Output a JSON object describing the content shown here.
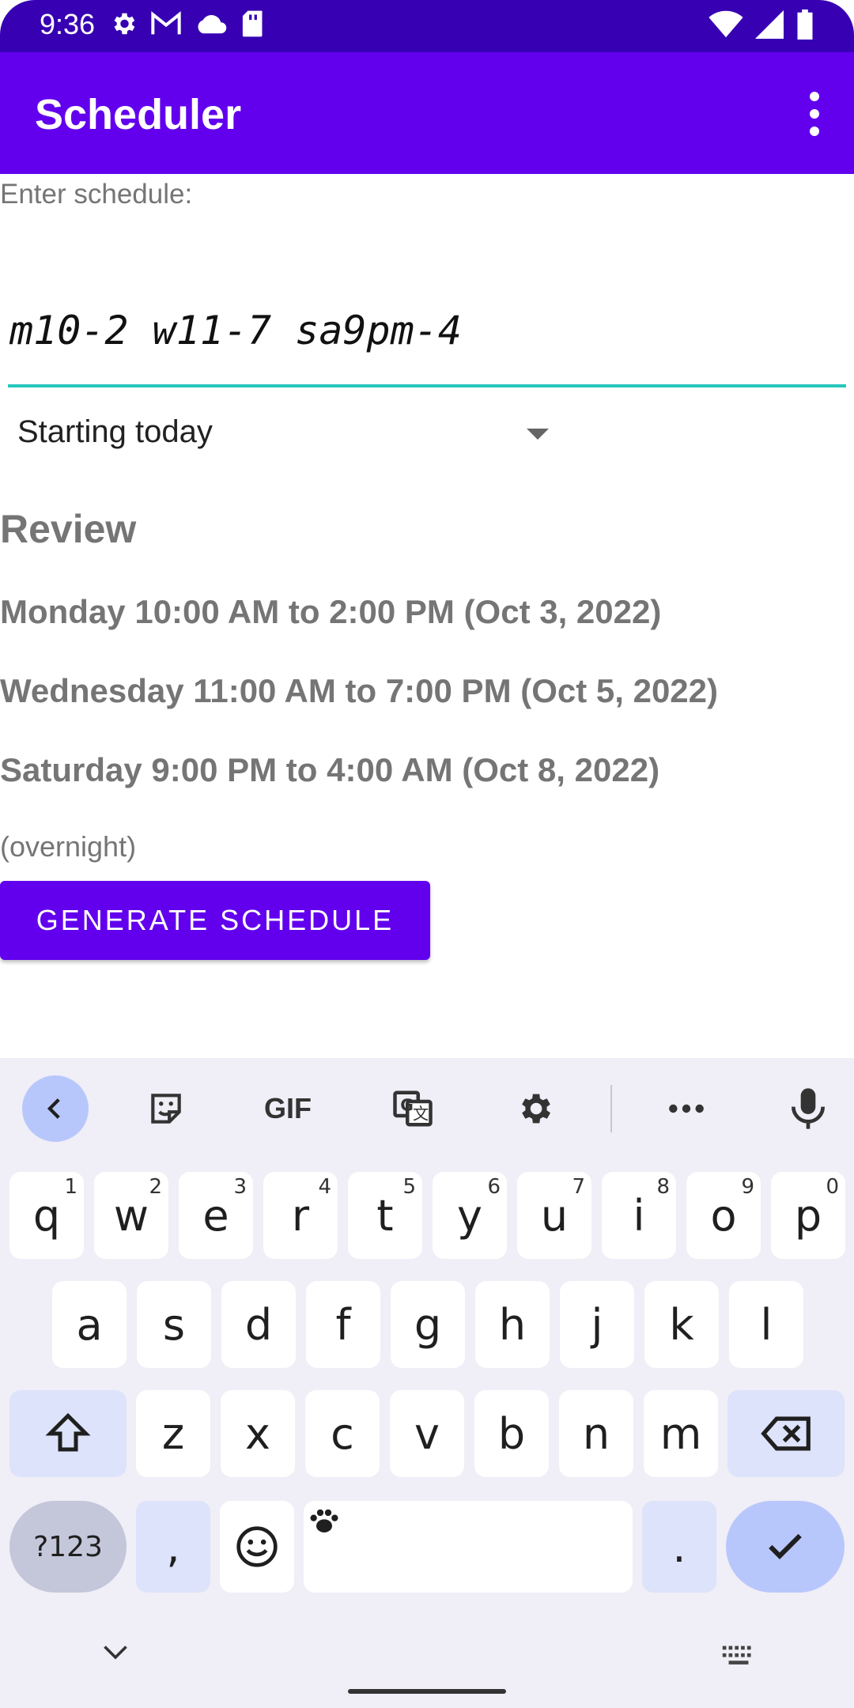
{
  "status_bar": {
    "time": "9:36",
    "left_icons": [
      "settings-icon",
      "gmail-icon",
      "cloud-icon",
      "sd-card-icon"
    ],
    "right_icons": [
      "wifi-icon",
      "signal-icon",
      "battery-icon"
    ]
  },
  "app_bar": {
    "title": "Scheduler",
    "overflow_icon": "more-vert-icon"
  },
  "form": {
    "label": "Enter schedule:",
    "input_value": "m10-2 w11-7 sa9pm-4",
    "spinner_value": "Starting today"
  },
  "review": {
    "title": "Review",
    "lines": [
      "Monday 10:00 AM to 2:00 PM (Oct 3, 2022)",
      "Wednesday 11:00 AM to 7:00 PM (Oct 5, 2022)",
      "Saturday 9:00 PM to 4:00 AM (Oct 8, 2022)"
    ],
    "note": "(overnight)"
  },
  "generate_button": "GENERATE SCHEDULE",
  "keyboard": {
    "toolbar": [
      "back-icon",
      "sticker-icon",
      "GIF",
      "translate-icon",
      "gear-icon",
      "more-horiz-icon",
      "mic-icon"
    ],
    "row1": [
      {
        "k": "q",
        "n": "1"
      },
      {
        "k": "w",
        "n": "2"
      },
      {
        "k": "e",
        "n": "3"
      },
      {
        "k": "r",
        "n": "4"
      },
      {
        "k": "t",
        "n": "5"
      },
      {
        "k": "y",
        "n": "6"
      },
      {
        "k": "u",
        "n": "7"
      },
      {
        "k": "i",
        "n": "8"
      },
      {
        "k": "o",
        "n": "9"
      },
      {
        "k": "p",
        "n": "0"
      }
    ],
    "row2": [
      "a",
      "s",
      "d",
      "f",
      "g",
      "h",
      "j",
      "k",
      "l"
    ],
    "row3": [
      "z",
      "x",
      "c",
      "v",
      "b",
      "n",
      "m"
    ],
    "symbols_key": "?123",
    "comma_key": ",",
    "period_key": ".",
    "accent_color": "#6200ee"
  }
}
